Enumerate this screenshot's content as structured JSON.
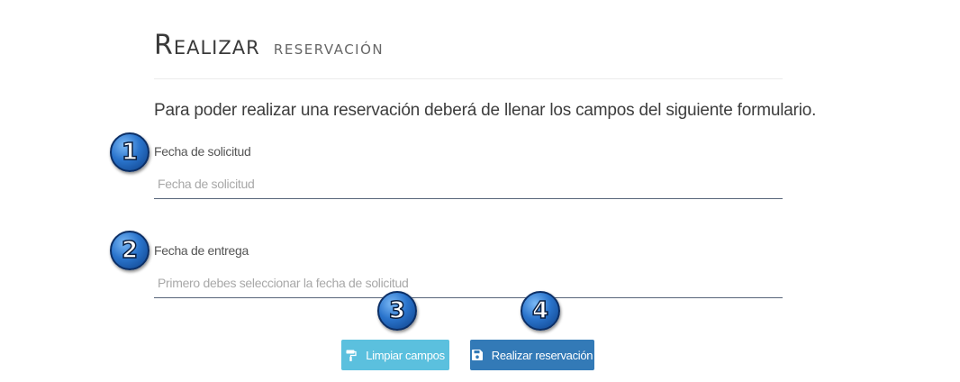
{
  "header": {
    "title_main": "Realizar",
    "title_sub": "reservación"
  },
  "intro": "Para poder realizar una reservación deberá de llenar los campos del siguiente formulario.",
  "form": {
    "fecha_solicitud": {
      "label": "Fecha de solicitud",
      "placeholder": "Fecha de solicitud",
      "value": ""
    },
    "fecha_entrega": {
      "label": "Fecha de entrega",
      "placeholder": "Primero debes seleccionar la fecha de solicitud",
      "value": ""
    }
  },
  "buttons": {
    "clear": {
      "label": "Limpiar campos",
      "icon": "paint-roller-icon",
      "color": "#5bc0de"
    },
    "submit": {
      "label": "Realizar reservación",
      "icon": "floppy-disk-icon",
      "color": "#337ab7"
    }
  },
  "badges": [
    "1",
    "2",
    "3",
    "4"
  ]
}
